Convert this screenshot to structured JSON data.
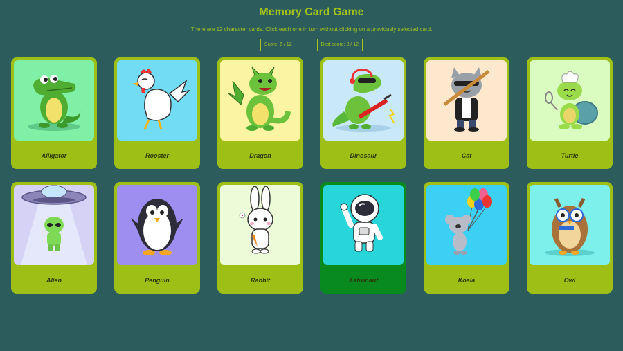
{
  "title": "Memory Card Game",
  "description": "There are 12 character cards. Click each one in turn without clicking on a previously selected card.",
  "score_label": "Score: 6 / 12",
  "best_score_label": "Best score: 0 / 12",
  "colors": {
    "background": "#2c5c5c",
    "accent": "#a4c21c",
    "card": "#9ebf15",
    "card_selected": "#098a1f"
  },
  "cards": [
    {
      "name": "Alligator",
      "bg": "#7ff0a6",
      "icon": "alligator-icon"
    },
    {
      "name": "Rooster",
      "bg": "#72dcf5",
      "icon": "rooster-icon"
    },
    {
      "name": "Dragon",
      "bg": "#fbf4a3",
      "icon": "dragon-icon"
    },
    {
      "name": "Dinosaur",
      "bg": "#c9e8fa",
      "icon": "dinosaur-icon"
    },
    {
      "name": "Cat",
      "bg": "#fde8cd",
      "icon": "cat-icon"
    },
    {
      "name": "Turtle",
      "bg": "#dafcc1",
      "icon": "turtle-icon"
    },
    {
      "name": "Alien",
      "bg": "#d6d2f5",
      "icon": "alien-icon"
    },
    {
      "name": "Penguin",
      "bg": "#9d8ef0",
      "icon": "penguin-icon"
    },
    {
      "name": "Rabbit",
      "bg": "#ecfcd9",
      "icon": "rabbit-icon"
    },
    {
      "name": "Astronaut",
      "bg": "#28d6d9",
      "icon": "astronaut-icon",
      "selected": true
    },
    {
      "name": "Koala",
      "bg": "#3cd0f5",
      "icon": "koala-icon"
    },
    {
      "name": "Owl",
      "bg": "#7df0ec",
      "icon": "owl-icon"
    }
  ]
}
